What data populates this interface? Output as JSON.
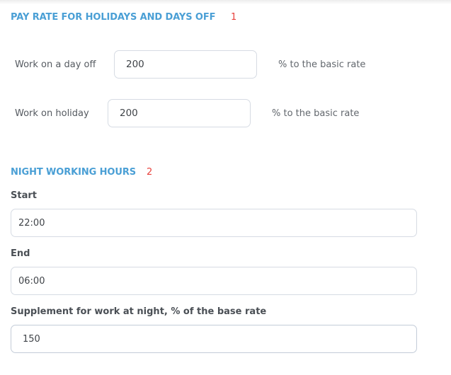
{
  "pay_rate_section": {
    "title": "PAY RATE FOR HOLIDAYS AND DAYS OFF",
    "marker": "1",
    "rows": [
      {
        "label": "Work on a day off",
        "value": "200",
        "suffix": "% to the basic rate"
      },
      {
        "label": "Work on holiday",
        "value": "200",
        "suffix": "% to the basic rate"
      }
    ]
  },
  "night_section": {
    "title": "NIGHT WORKING HOURS",
    "marker": "2",
    "start": {
      "label": "Start",
      "value": "22:00"
    },
    "end": {
      "label": "End",
      "value": "06:00"
    },
    "supplement": {
      "label": "Supplement for work at night, % of the base rate",
      "value": "150"
    }
  },
  "colors": {
    "section_title": "#4a9fd5",
    "marker": "#e8413c",
    "input_border": "#d6dbe3"
  }
}
